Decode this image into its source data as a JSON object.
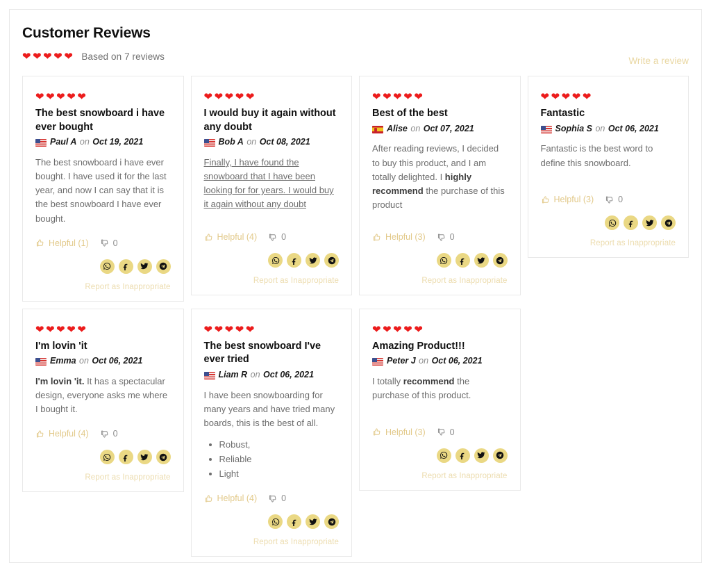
{
  "header": {
    "title": "Customer Reviews",
    "rating_hearts": 5,
    "based_on": "Based on 7 reviews",
    "write_review_label": "Write a review"
  },
  "labels": {
    "helpful_prefix": "Helpful",
    "report_label": "Report as Inappropriate",
    "on_word": "on"
  },
  "colors": {
    "heart": "#ec1c1c",
    "accent_gold": "#ead884",
    "link_gold": "#e9d7a2",
    "report_gold": "#ecdcae",
    "body_text": "#6d6d6d",
    "card_border": "#e9e9e9"
  },
  "share_buttons": [
    {
      "name": "whatsapp",
      "label": "WhatsApp"
    },
    {
      "name": "facebook",
      "label": "Facebook"
    },
    {
      "name": "twitter",
      "label": "Twitter"
    },
    {
      "name": "telegram",
      "label": "Telegram"
    }
  ],
  "reviews": [
    {
      "hearts": 5,
      "title": "The best snowboard i have ever bought",
      "flag": "us",
      "author": "Paul A",
      "date": "Oct 19, 2021",
      "body": "The best snowboard i have ever bought. I have used it for the last year, and now I can say that it is the best snowboard I have ever bought.",
      "helpful": "Helpful (1)",
      "unhelpful": "0",
      "report": "Report as Inappropriate"
    },
    {
      "hearts": 5,
      "title": "I would buy it again without any doubt",
      "flag": "us",
      "author": "Bob A",
      "date": "Oct 08, 2021",
      "body": "Finally, I have found the snowboard that I have been looking for for years. I would buy it again without any doubt",
      "underlined": true,
      "helpful": "Helpful (4)",
      "unhelpful": "0",
      "report": "Report as Inappropriate"
    },
    {
      "hearts": 5,
      "title": "Best of the best",
      "flag": "es",
      "author": "Alise",
      "date": "Oct 07, 2021",
      "body_pre": "After reading reviews, I decided to buy this product, and I am totally delighted. I ",
      "body_bold": "highly recommend",
      "body_post": " the purchase of this product",
      "helpful": "Helpful (3)",
      "unhelpful": "0",
      "report": "Report as Inappropriate"
    },
    {
      "hearts": 5,
      "title": "Fantastic",
      "flag": "us",
      "author": "Sophia S",
      "date": "Oct 06, 2021",
      "body": "Fantastic is the best word to define this snowboard.",
      "helpful": "Helpful (3)",
      "unhelpful": "0",
      "report": "Report as Inappropriate"
    },
    {
      "hearts": 5,
      "title": "I'm lovin 'it",
      "flag": "us",
      "author": "Emma",
      "date": "Oct 06, 2021",
      "body_bold": "I'm lovin 'it.",
      "body_post": " It has a spectacular design, everyone asks me where I bought it.",
      "helpful": "Helpful (4)",
      "unhelpful": "0",
      "report": "Report as Inappropriate"
    },
    {
      "hearts": 5,
      "title": "The best snowboard I've ever tried",
      "flag": "us",
      "author": "Liam R",
      "date": "Oct 06, 2021",
      "body": "I have been snowboarding for many years and have tried many boards, this is the best of all.",
      "bullets": [
        "Robust,",
        "Reliable",
        "Light"
      ],
      "helpful": "Helpful (4)",
      "unhelpful": "0",
      "report": "Report as Inappropriate"
    },
    {
      "hearts": 5,
      "title": "Amazing Product!!!",
      "flag": "us",
      "author": "Peter J",
      "date": "Oct 06, 2021",
      "body_pre": "I totally ",
      "body_bold": "recommend",
      "body_post": " the purchase of this product.",
      "helpful": "Helpful (3)",
      "unhelpful": "0",
      "report": "Report as Inappropriate"
    }
  ]
}
